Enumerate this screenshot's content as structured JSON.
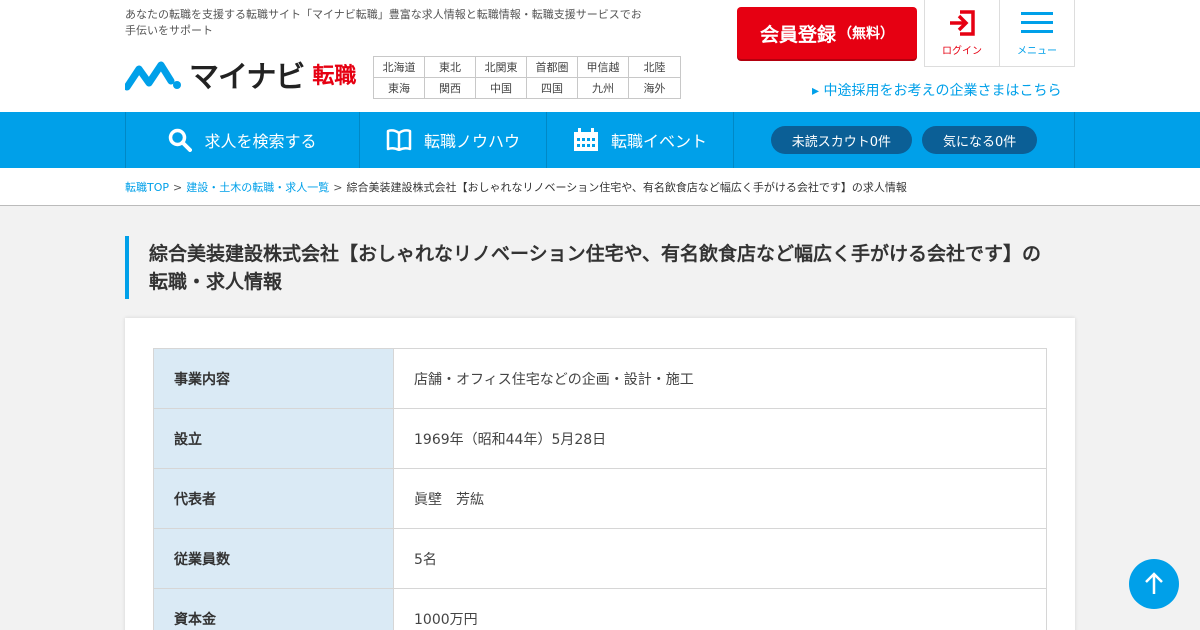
{
  "header": {
    "tagline": "あなたの転職を支援する転職サイト「マイナビ転職」豊富な求人情報と転職情報・転職支援サービスでお手伝いをサポート",
    "logo_text": "マイナビ",
    "logo_sub": "転職",
    "regions": [
      "北海道",
      "東北",
      "北関東",
      "首都圏",
      "甲信越",
      "北陸",
      "東海",
      "関西",
      "中国",
      "四国",
      "九州",
      "海外"
    ],
    "register_label": "会員登録",
    "register_sub": "（無料）",
    "login_label": "ログイン",
    "menu_label": "メニュー",
    "corp_link": "▸ 中途採用をお考えの企業さまはこちら"
  },
  "nav": {
    "search_label": "求人を検索する",
    "knowhow_label": "転職ノウハウ",
    "event_label": "転職イベント",
    "scout_label": "未読スカウト0件",
    "favorite_label": "気になる0件"
  },
  "breadcrumb": {
    "home": "転職TOP",
    "category": "建設・土木の転職・求人一覧",
    "current": "綜合美装建設株式会社【おしゃれなリノベーション住宅や、有名飲食店など幅広く手がける会社です】の求人情報",
    "separator": ">"
  },
  "page": {
    "title": "綜合美装建設株式会社【おしゃれなリノベーション住宅や、有名飲食店など幅広く手がける会社です】の転職・求人情報"
  },
  "company_info": {
    "rows": [
      {
        "label": "事業内容",
        "value": "店舗・オフィス住宅などの企画・設計・施工"
      },
      {
        "label": "設立",
        "value": "1969年（昭和44年）5月28日"
      },
      {
        "label": "代表者",
        "value": "眞壁　芳紘"
      },
      {
        "label": "従業員数",
        "value": "5名"
      },
      {
        "label": "資本金",
        "value": "1000万円"
      }
    ]
  },
  "colors": {
    "brand_blue": "#00a0e9",
    "brand_red": "#e60012",
    "pill_bg": "#0b5f96",
    "table_header_bg": "#daeaf5"
  }
}
